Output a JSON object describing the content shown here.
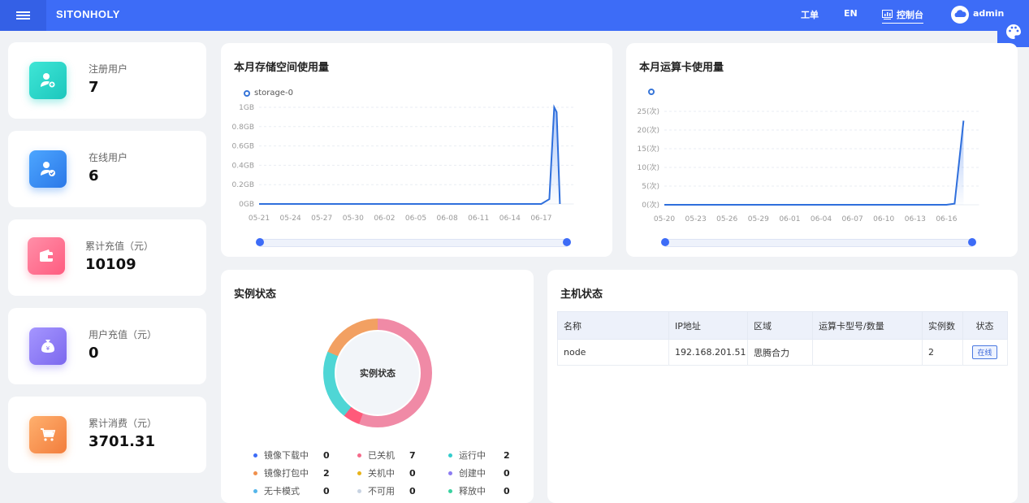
{
  "header": {
    "brand": "SITONHOLY",
    "workorder": "工单",
    "lang": "EN",
    "console": "控制台",
    "user": "admin"
  },
  "stats": [
    {
      "label": "注册用户",
      "value": "7",
      "icon": "user-add-icon",
      "color": "#26d4c8"
    },
    {
      "label": "在线用户",
      "value": "6",
      "icon": "user-check-icon",
      "color": "#3c8cf2"
    },
    {
      "label": "累计充值（元）",
      "value": "10109",
      "icon": "wallet-icon",
      "color": "#ff6c8c"
    },
    {
      "label": "用户充值（元）",
      "value": "0",
      "icon": "money-bag-icon",
      "color": "#8c7cf2"
    },
    {
      "label": "累计消费（元）",
      "value": "3701.31",
      "icon": "cart-icon",
      "color": "#f6924c"
    }
  ],
  "storage_card": {
    "title": "本月存储空间使用量"
  },
  "gpu_card": {
    "title": "本月运算卡使用量"
  },
  "chart_data": [
    {
      "type": "line",
      "title": "本月存储空间使用量",
      "series": [
        {
          "name": "storage-0",
          "color": "#2f6fdc",
          "points": [
            [
              "05-21",
              0
            ],
            [
              "05-24",
              0
            ],
            [
              "05-27",
              0
            ],
            [
              "05-30",
              0
            ],
            [
              "06-02",
              0
            ],
            [
              "06-05",
              0
            ],
            [
              "06-08",
              0
            ],
            [
              "06-11",
              0
            ],
            [
              "06-14",
              0
            ],
            [
              "06-16",
              0
            ],
            [
              "06-17",
              0.05
            ],
            [
              "06-17.5",
              1
            ],
            [
              "06-18",
              0.95
            ],
            [
              "06-18.5",
              0
            ]
          ]
        }
      ],
      "x_ticks": [
        "05-21",
        "05-24",
        "05-27",
        "05-30",
        "06-02",
        "06-05",
        "06-08",
        "06-11",
        "06-14",
        "06-17"
      ],
      "y_ticks": [
        "0GB",
        "0.2GB",
        "0.4GB",
        "0.6GB",
        "0.8GB",
        "1GB"
      ],
      "ylim": [
        0,
        1
      ]
    },
    {
      "type": "line",
      "title": "本月运算卡使用量",
      "series": [
        {
          "color": "#2f6fdc",
          "points": [
            [
              "05-20",
              0
            ],
            [
              "05-23",
              0
            ],
            [
              "05-26",
              0
            ],
            [
              "05-29",
              0
            ],
            [
              "06-01",
              0
            ],
            [
              "06-04",
              0
            ],
            [
              "06-07",
              0
            ],
            [
              "06-10",
              0
            ],
            [
              "06-13",
              0
            ],
            [
              "06-16",
              0
            ],
            [
              "06-17",
              0.3
            ],
            [
              "06-18",
              22.5
            ]
          ]
        }
      ],
      "x_ticks": [
        "05-20",
        "05-23",
        "05-26",
        "05-29",
        "06-01",
        "06-04",
        "06-07",
        "06-10",
        "06-13",
        "06-16"
      ],
      "y_ticks": [
        "0(次)",
        "5(次)",
        "10(次)",
        "15(次)",
        "20(次)",
        "25(次)"
      ],
      "ylim": [
        0,
        25
      ]
    }
  ],
  "instance": {
    "title": "实例状态",
    "center": "实例状态",
    "items": [
      {
        "label": "镜像下载中",
        "count": "0",
        "color": "#3d6cf7"
      },
      {
        "label": "已关机",
        "count": "7",
        "color": "#f56a8a"
      },
      {
        "label": "运行中",
        "count": "2",
        "color": "#33cccc"
      },
      {
        "label": "镜像打包中",
        "count": "2",
        "color": "#f0904d"
      },
      {
        "label": "关机中",
        "count": "0",
        "color": "#e8b31a"
      },
      {
        "label": "创建中",
        "count": "0",
        "color": "#8c7cf2"
      },
      {
        "label": "无卡模式",
        "count": "0",
        "color": "#55b6ea"
      },
      {
        "label": "不可用",
        "count": "0",
        "color": "#c8d3e2"
      },
      {
        "label": "释放中",
        "count": "0",
        "color": "#3ad1a0"
      }
    ]
  },
  "host": {
    "title": "主机状态",
    "columns": [
      "名称",
      "IP地址",
      "区域",
      "运算卡型号/数量",
      "实例数",
      "状态"
    ],
    "rows": [
      {
        "name": "node",
        "ip": "192.168.201.51",
        "region": "思腾合力",
        "gpu": "",
        "instances": "2",
        "status": "在线"
      }
    ]
  }
}
